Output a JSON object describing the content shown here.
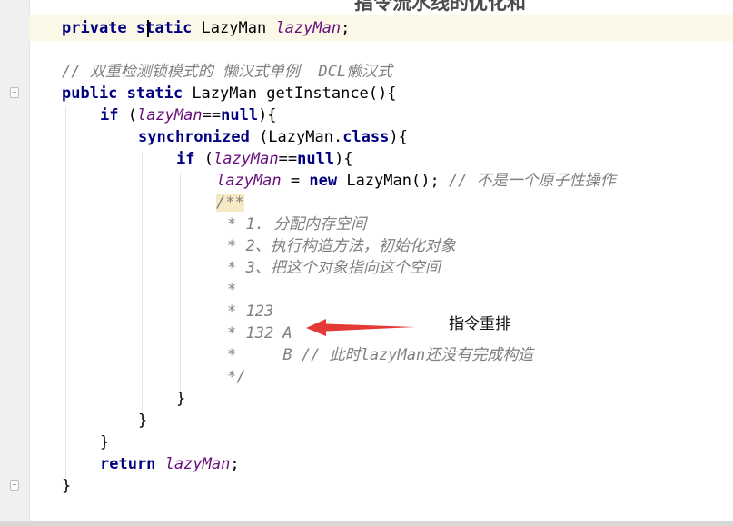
{
  "editor": {
    "top_title": "指令流水线的优化和",
    "lines": {
      "l1": {
        "kw1": "private ",
        "kw2": "static ",
        "type": "LazyMan ",
        "field": "lazyMan",
        "end": ";"
      },
      "l2": {
        "comment": "// 双重检测锁模式的 懒汉式单例  DCL懒汉式"
      },
      "l3": {
        "kw1": "public ",
        "kw2": "static ",
        "type": "LazyMan ",
        "name": "getInstance(){"
      },
      "l4": {
        "kw": "if ",
        "open": "(",
        "field": "lazyMan",
        "op": "==",
        "kw2": "null",
        "close": "){"
      },
      "l5": {
        "kw": "synchronized ",
        "rest": "(LazyMan.",
        "kw2": "class",
        "close": "){"
      },
      "l6": {
        "kw": "if ",
        "open": "(",
        "field": "lazyMan",
        "op": "==",
        "kw2": "null",
        "close": "){"
      },
      "l7": {
        "field": "lazyMan",
        "op": " = ",
        "kw": "new ",
        "call": "LazyMan(); ",
        "comment": "// 不是一个原子性操作"
      },
      "l8": {
        "doc": "/**"
      },
      "l9": {
        "doc": "* 1. 分配内存空间"
      },
      "l10": {
        "doc": "* 2、执行构造方法，初始化对象"
      },
      "l11": {
        "doc": "* 3、把这个对象指向这个空间"
      },
      "l12": {
        "doc": "*"
      },
      "l13": {
        "doc": "* 123"
      },
      "l14": {
        "doc": "* 132 A"
      },
      "l15": {
        "doc": "*     B // 此时lazyMan还没有完成构造"
      },
      "l16": {
        "doc": "*/"
      },
      "l17": {
        "text": "}"
      },
      "l18": {
        "text": "}"
      },
      "l19": {
        "text": "}"
      },
      "l20": {
        "kw": "return ",
        "field": "lazyMan",
        "end": ";"
      },
      "l21": {
        "text": "}"
      }
    }
  },
  "annotation": {
    "label": "指令重排",
    "color": "#e53935"
  },
  "colors": {
    "keyword": "#000080",
    "field": "#660e7a",
    "comment": "#808080",
    "caret_row": "#fbf8e8"
  }
}
